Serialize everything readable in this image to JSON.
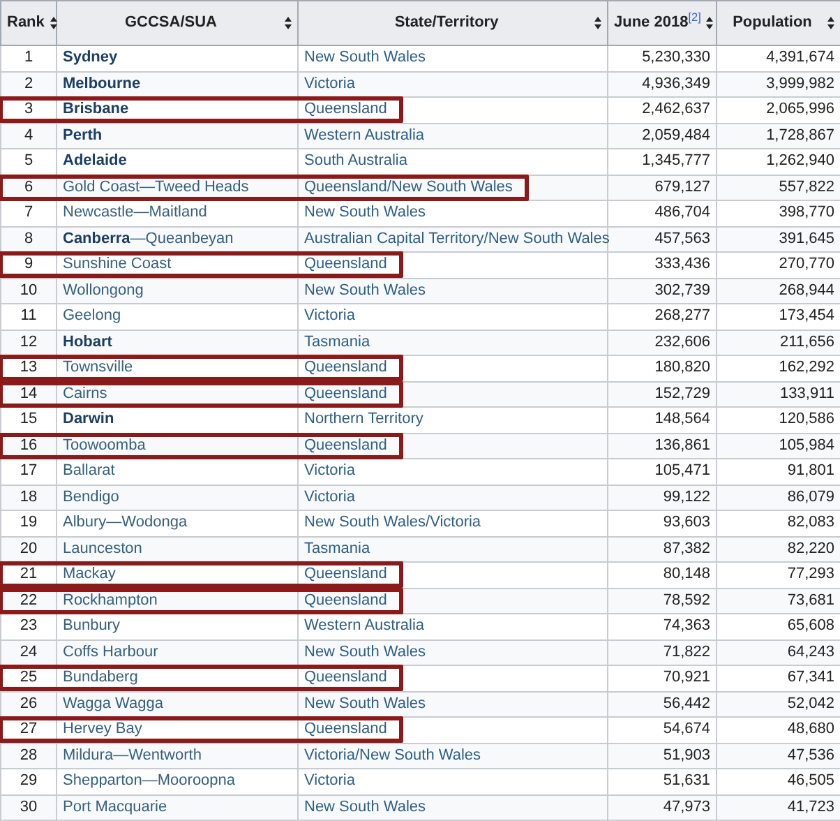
{
  "columns": [
    {
      "label": "Rank"
    },
    {
      "label": "GCCSA/SUA"
    },
    {
      "label": "State/Territory"
    },
    {
      "label": "June 2018$^{[2]}$"
    },
    {
      "label": "Population"
    }
  ],
  "rows": [
    {
      "rank": "1",
      "name": "Sydney",
      "bold": true,
      "state": "New South Wales",
      "june_2018": "5,230,330",
      "population": "4,391,674",
      "highlighted": false
    },
    {
      "rank": "2",
      "name": "Melbourne",
      "bold": true,
      "state": "Victoria",
      "june_2018": "4,936,349",
      "population": "3,999,982",
      "highlighted": false
    },
    {
      "rank": "3",
      "name": "Brisbane",
      "bold": true,
      "state": "Queensland",
      "june_2018": "2,462,637",
      "population": "2,065,996",
      "highlighted": true
    },
    {
      "rank": "4",
      "name": "Perth",
      "bold": true,
      "state": "Western Australia",
      "june_2018": "2,059,484",
      "population": "1,728,867",
      "highlighted": false
    },
    {
      "rank": "5",
      "name": "Adelaide",
      "bold": true,
      "state": "South Australia",
      "june_2018": "1,345,777",
      "population": "1,262,940",
      "highlighted": false
    },
    {
      "rank": "6",
      "name": "Gold Coast—Tweed Heads",
      "bold": false,
      "state": "Queensland/New South Wales",
      "june_2018": "679,127",
      "population": "557,822",
      "highlighted": true
    },
    {
      "rank": "7",
      "name": "Newcastle—Maitland",
      "bold": false,
      "state": "New South Wales",
      "june_2018": "486,704",
      "population": "398,770",
      "highlighted": false
    },
    {
      "rank": "8",
      "name": "**Canberra**—Queanbeyan",
      "bold": false,
      "state": "Australian Capital Territory/New South Wales",
      "june_2018": "457,563",
      "population": "391,645",
      "highlighted": false
    },
    {
      "rank": "9",
      "name": "Sunshine Coast",
      "bold": false,
      "state": "Queensland",
      "june_2018": "333,436",
      "population": "270,770",
      "highlighted": true
    },
    {
      "rank": "10",
      "name": "Wollongong",
      "bold": false,
      "state": "New South Wales",
      "june_2018": "302,739",
      "population": "268,944",
      "highlighted": false
    },
    {
      "rank": "11",
      "name": "Geelong",
      "bold": false,
      "state": "Victoria",
      "june_2018": "268,277",
      "population": "173,454",
      "highlighted": false
    },
    {
      "rank": "12",
      "name": "Hobart",
      "bold": true,
      "state": "Tasmania",
      "june_2018": "232,606",
      "population": "211,656",
      "highlighted": false
    },
    {
      "rank": "13",
      "name": "Townsville",
      "bold": false,
      "state": "Queensland",
      "june_2018": "180,820",
      "population": "162,292",
      "highlighted": true
    },
    {
      "rank": "14",
      "name": "Cairns",
      "bold": false,
      "state": "Queensland",
      "june_2018": "152,729",
      "population": "133,911",
      "highlighted": true
    },
    {
      "rank": "15",
      "name": "Darwin",
      "bold": true,
      "state": "Northern Territory",
      "june_2018": "148,564",
      "population": "120,586",
      "highlighted": false
    },
    {
      "rank": "16",
      "name": "Toowoomba",
      "bold": false,
      "state": "Queensland",
      "june_2018": "136,861",
      "population": "105,984",
      "highlighted": true
    },
    {
      "rank": "17",
      "name": "Ballarat",
      "bold": false,
      "state": "Victoria",
      "june_2018": "105,471",
      "population": "91,801",
      "highlighted": false
    },
    {
      "rank": "18",
      "name": "Bendigo",
      "bold": false,
      "state": "Victoria",
      "june_2018": "99,122",
      "population": "86,079",
      "highlighted": false
    },
    {
      "rank": "19",
      "name": "Albury—Wodonga",
      "bold": false,
      "state": "New South Wales/Victoria",
      "june_2018": "93,603",
      "population": "82,083",
      "highlighted": false
    },
    {
      "rank": "20",
      "name": "Launceston",
      "bold": false,
      "state": "Tasmania",
      "june_2018": "87,382",
      "population": "82,220",
      "highlighted": false
    },
    {
      "rank": "21",
      "name": "Mackay",
      "bold": false,
      "state": "Queensland",
      "june_2018": "80,148",
      "population": "77,293",
      "highlighted": true
    },
    {
      "rank": "22",
      "name": "Rockhampton",
      "bold": false,
      "state": "Queensland",
      "june_2018": "78,592",
      "population": "73,681",
      "highlighted": true
    },
    {
      "rank": "23",
      "name": "Bunbury",
      "bold": false,
      "state": "Western Australia",
      "june_2018": "74,363",
      "population": "65,608",
      "highlighted": false
    },
    {
      "rank": "24",
      "name": "Coffs Harbour",
      "bold": false,
      "state": "New South Wales",
      "june_2018": "71,822",
      "population": "64,243",
      "highlighted": false
    },
    {
      "rank": "25",
      "name": "Bundaberg",
      "bold": false,
      "state": "Queensland",
      "june_2018": "70,921",
      "population": "67,341",
      "highlighted": true
    },
    {
      "rank": "26",
      "name": "Wagga Wagga",
      "bold": false,
      "state": "New South Wales",
      "june_2018": "56,442",
      "population": "52,042",
      "highlighted": false
    },
    {
      "rank": "27",
      "name": "Hervey Bay",
      "bold": false,
      "state": "Queensland",
      "june_2018": "54,674",
      "population": "48,680",
      "highlighted": true
    },
    {
      "rank": "28",
      "name": "Mildura—Wentworth",
      "bold": false,
      "state": "Victoria/New South Wales",
      "june_2018": "51,903",
      "population": "47,536",
      "highlighted": false
    },
    {
      "rank": "29",
      "name": "Shepparton—Mooroopna",
      "bold": false,
      "state": "Victoria",
      "june_2018": "51,631",
      "population": "46,505",
      "highlighted": false
    },
    {
      "rank": "30",
      "name": "Port Macquarie",
      "bold": false,
      "state": "New South Wales",
      "june_2018": "47,973",
      "population": "41,723",
      "highlighted": false
    }
  ]
}
